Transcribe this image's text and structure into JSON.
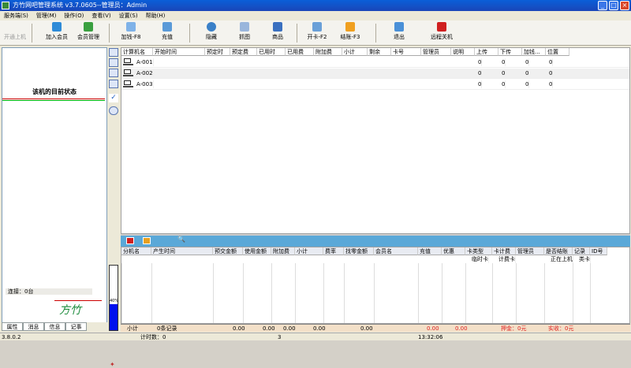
{
  "window": {
    "title": "方竹网吧管理系统 v3.7.0605--管理员：Admin"
  },
  "menu": [
    "服务端(S)",
    "管理(M)",
    "操作(O)",
    "查看(V)",
    "设置(S)",
    "帮助(H)"
  ],
  "toolbar": {
    "left_status": "开通上机",
    "buttons": [
      "加入会员",
      "会员管理",
      "加钱-F8",
      "充值",
      "隐藏",
      "抓图",
      "商品",
      "开卡-F2",
      "结账-F3",
      "退出",
      "远程关机"
    ]
  },
  "left_panel": {
    "title": "该机的目前状态",
    "connection": "连接：0台",
    "logo": "方竹",
    "tabs": [
      "属性",
      "消息",
      "信息",
      "记事"
    ]
  },
  "grid1": {
    "columns": [
      "计算机名",
      "开始时间",
      "预定时",
      "预定费",
      "已用时",
      "已用费",
      "附加费",
      "小计",
      "剩余",
      "卡号",
      "管理员",
      "说明",
      "上传",
      "下传",
      "加钱...",
      "位置"
    ],
    "rows": [
      {
        "name": "A-001",
        "upload": "0",
        "download": "0",
        "add": "0",
        "pos": "0"
      },
      {
        "name": "A-002",
        "upload": "0",
        "download": "0",
        "add": "0",
        "pos": "0"
      },
      {
        "name": "A-003",
        "upload": "0",
        "download": "0",
        "add": "0",
        "pos": "0"
      }
    ]
  },
  "gauge": {
    "label": "40%",
    "level": 0.4
  },
  "grid2": {
    "columns": [
      "分机名",
      "产生时间",
      "预交金额",
      "使用金额",
      "附加费",
      "小计",
      "费率",
      "找零金额",
      "会员名",
      "充值",
      "优惠",
      "卡类型",
      "卡计费",
      "管理员",
      "是否结账",
      "记录",
      "ID号"
    ],
    "subrow": {
      "card_type": "临时卡",
      "card_fee": "计费卡",
      "settled": "正在上机",
      "record": "类卡"
    }
  },
  "summary": {
    "label": "小计",
    "count": "0条记录",
    "v1": "0.00",
    "v2": "0.00",
    "v3": "0.00",
    "v4": "0.00",
    "v5": "0.00",
    "v6": "0.00",
    "v7": "0.00",
    "deposit": "押金：0元",
    "real": "实收：0元"
  },
  "status": {
    "version": "3.8.0.2",
    "count": "计时数：0",
    "num": "3",
    "time": "13:32:06"
  },
  "colors": {
    "title": "#1a46b8",
    "toolbar2": "#5aa8d8",
    "gauge": "#0010ee",
    "logo": "#1a8a3a"
  }
}
